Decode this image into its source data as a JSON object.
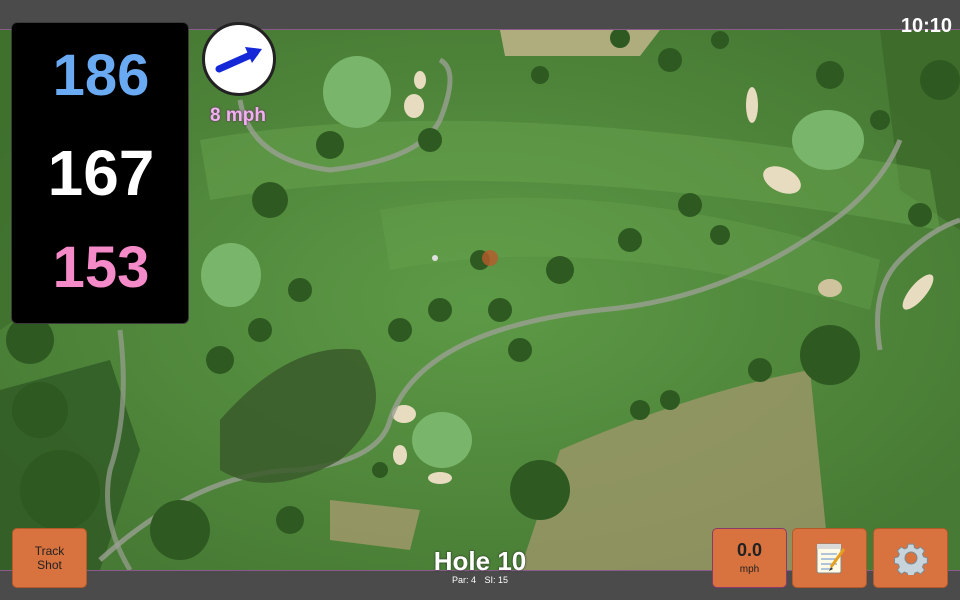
{
  "status": {
    "time": "10:10"
  },
  "distances": {
    "back": "186",
    "middle": "167",
    "front": "153"
  },
  "wind": {
    "speed_label": "8 mph",
    "icon": "wind-arrow-icon"
  },
  "track_button": {
    "line1": "Track",
    "line2": "Shot"
  },
  "hole": {
    "title": "Hole 10",
    "par": "Par: 4",
    "si": "SI: 15"
  },
  "speed_button": {
    "value": "0.0",
    "unit": "mph"
  },
  "notes_button": {
    "icon": "notepad-icon"
  },
  "settings_button": {
    "icon": "gear-icon"
  },
  "colors": {
    "back_distance": "#6aaaf2",
    "middle_distance": "#ffffff",
    "front_distance": "#f58ac8",
    "button": "#d8723e",
    "wind_label": "#f1b0f0"
  }
}
